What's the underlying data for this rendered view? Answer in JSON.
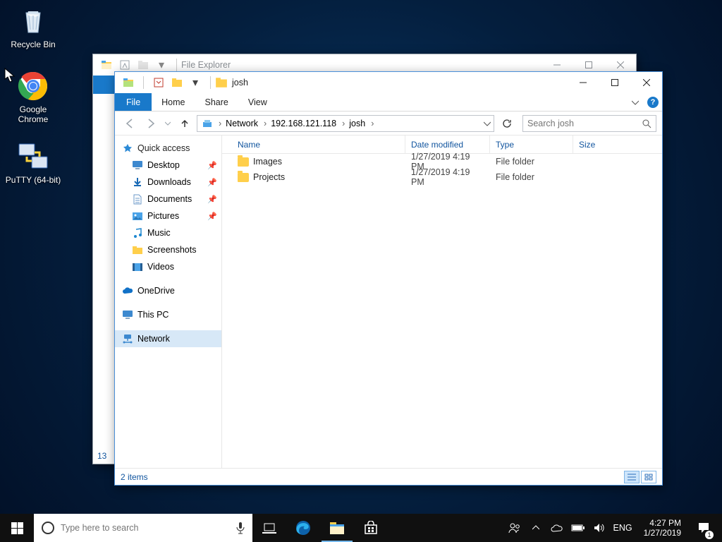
{
  "desktop_icons": [
    {
      "name": "Recycle Bin"
    },
    {
      "name": "Google Chrome"
    },
    {
      "name": "PuTTY (64-bit)"
    }
  ],
  "bg_window": {
    "title": "File Explorer",
    "status_left": "13"
  },
  "window": {
    "title": "josh",
    "ribbon": {
      "file": "File",
      "tabs": [
        "Home",
        "Share",
        "View"
      ]
    },
    "breadcrumb": [
      "Network",
      "192.168.121.118",
      "josh"
    ],
    "search_placeholder": "Search josh",
    "columns": {
      "name": "Name",
      "date": "Date modified",
      "type": "Type",
      "size": "Size"
    },
    "col_widths": {
      "name": 246,
      "date": 120,
      "type": 118,
      "size": 70
    },
    "rows": [
      {
        "name": "Images",
        "date": "1/27/2019 4:19 PM",
        "type": "File folder",
        "size": ""
      },
      {
        "name": "Projects",
        "date": "1/27/2019 4:19 PM",
        "type": "File folder",
        "size": ""
      }
    ],
    "status": "2 items",
    "sidebar": {
      "quick": "Quick access",
      "items": [
        {
          "label": "Desktop",
          "pin": true,
          "icon": "desktop"
        },
        {
          "label": "Downloads",
          "pin": true,
          "icon": "download"
        },
        {
          "label": "Documents",
          "pin": true,
          "icon": "document"
        },
        {
          "label": "Pictures",
          "pin": true,
          "icon": "picture"
        },
        {
          "label": "Music",
          "pin": false,
          "icon": "music"
        },
        {
          "label": "Screenshots",
          "pin": false,
          "icon": "folder"
        },
        {
          "label": "Videos",
          "pin": false,
          "icon": "video"
        }
      ],
      "onedrive": "OneDrive",
      "thispc": "This PC",
      "network": "Network"
    }
  },
  "taskbar": {
    "search_placeholder": "Type here to search",
    "lang": "ENG",
    "time": "4:27 PM",
    "date": "1/27/2019",
    "notif_count": "1"
  }
}
